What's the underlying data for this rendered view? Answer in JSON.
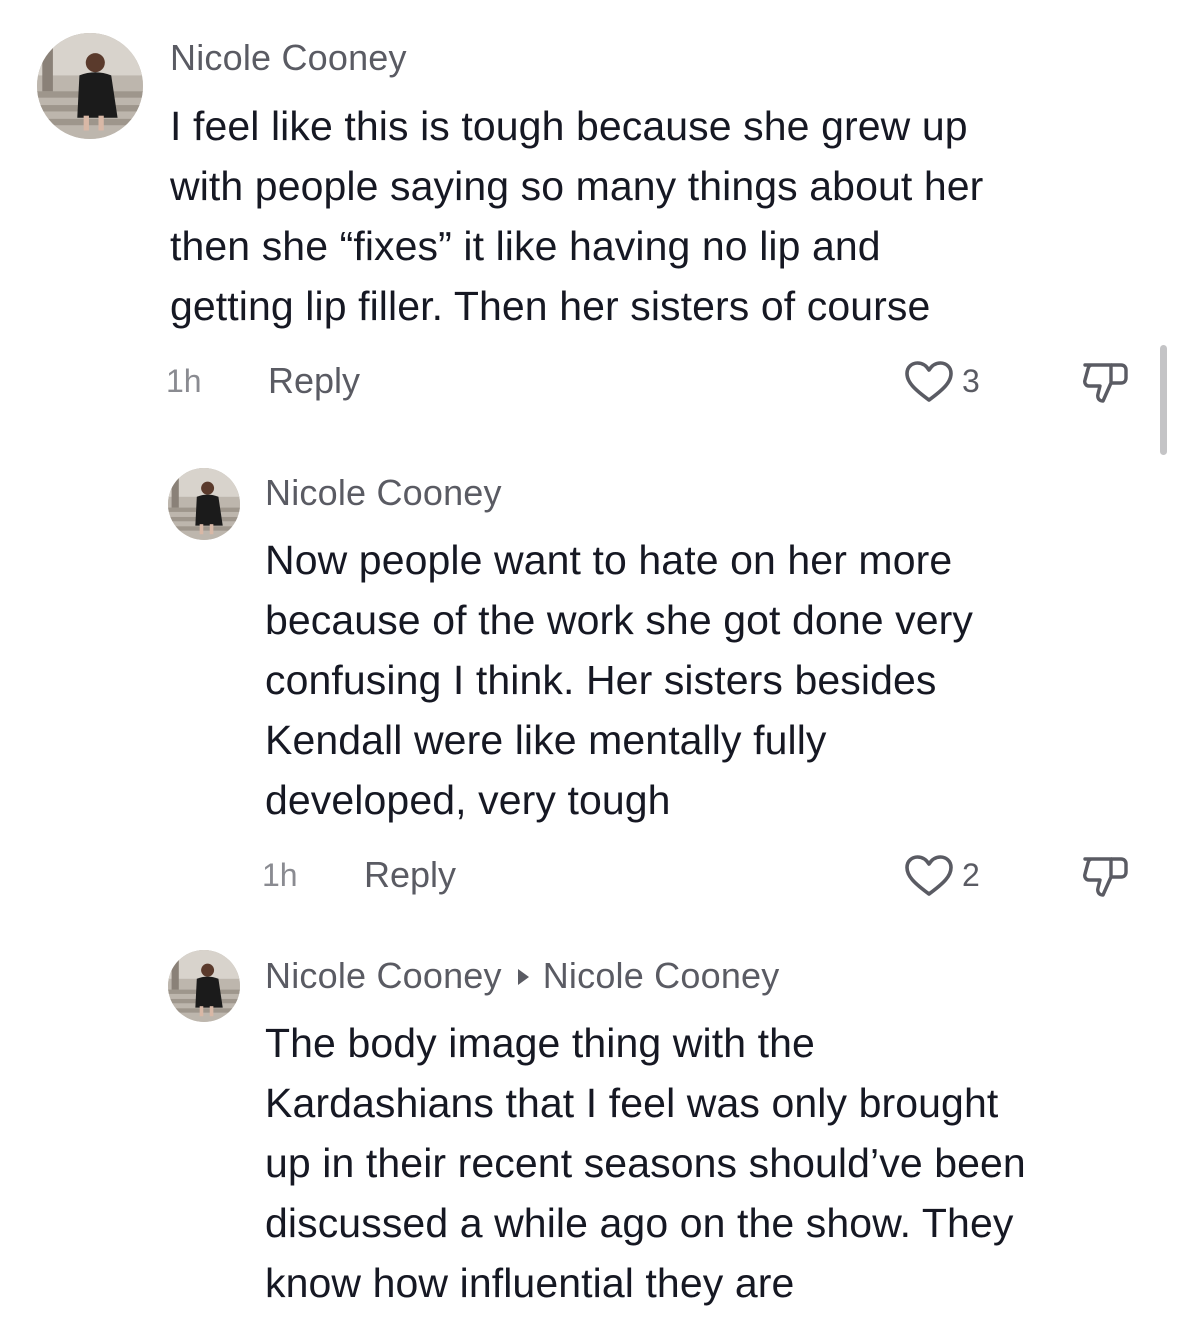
{
  "comments": [
    {
      "author": "Nicole Cooney",
      "lines": [
        "I feel like this is tough because she grew up",
        "with people saying so many things about her",
        "then she “fixes” it like having no lip and",
        "getting lip filler. Then her sisters of course"
      ],
      "time": "1h",
      "reply_label": "Reply",
      "likes": "3"
    },
    {
      "author": "Nicole Cooney",
      "lines": [
        "Now people want to hate on her more",
        "because of the work she got done very",
        "confusing I think. Her sisters besides",
        "Kendall were like mentally fully",
        "developed, very tough"
      ],
      "time": "1h",
      "reply_label": "Reply",
      "likes": "2"
    },
    {
      "author": "Nicole Cooney",
      "reply_to": "Nicole Cooney",
      "lines": [
        "The body image thing with the",
        "Kardashians that I feel was only brought",
        "up in their recent seasons should’ve been",
        "discussed a while ago on the show. They",
        "know how influential they are"
      ]
    }
  ],
  "colors": {
    "text": "#161823",
    "secondary": "#5a5b63",
    "muted": "#8a8b91"
  },
  "icons": [
    "heart-outline-icon",
    "thumbs-down-icon",
    "reply-arrow-icon"
  ]
}
